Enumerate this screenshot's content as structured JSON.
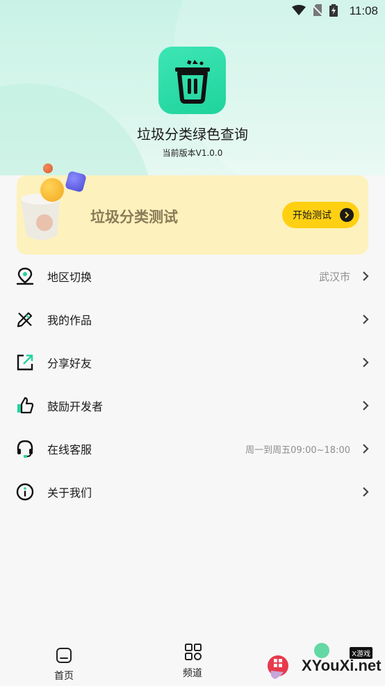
{
  "status_bar": {
    "time": "11:08"
  },
  "app": {
    "name": "垃圾分类绿色查询",
    "version": "当前版本V1.0.0"
  },
  "test_card": {
    "title": "垃圾分类测试",
    "button_label": "开始测试"
  },
  "menu": [
    {
      "label": "地区切换",
      "value": "武汉市",
      "icon": "location-pin-icon"
    },
    {
      "label": "我的作品",
      "value": "",
      "icon": "pencil-ruler-icon"
    },
    {
      "label": "分享好友",
      "value": "",
      "icon": "share-icon"
    },
    {
      "label": "鼓励开发者",
      "value": "",
      "icon": "thumbs-up-icon"
    },
    {
      "label": "在线客服",
      "value": "周一到周五09:00~18:00",
      "icon": "headset-icon"
    },
    {
      "label": "关于我们",
      "value": "",
      "icon": "info-icon"
    }
  ],
  "tabbar": {
    "tabs": [
      {
        "label": "首页",
        "icon": "home-icon"
      },
      {
        "label": "频道",
        "icon": "grid-icon"
      }
    ]
  },
  "watermark": {
    "text": "XYouXi.net",
    "badge": "X游戏"
  },
  "colors": {
    "accent_green": "#22d49f",
    "card_yellow": "#fdf1bd",
    "button_yellow": "#ffd012"
  }
}
